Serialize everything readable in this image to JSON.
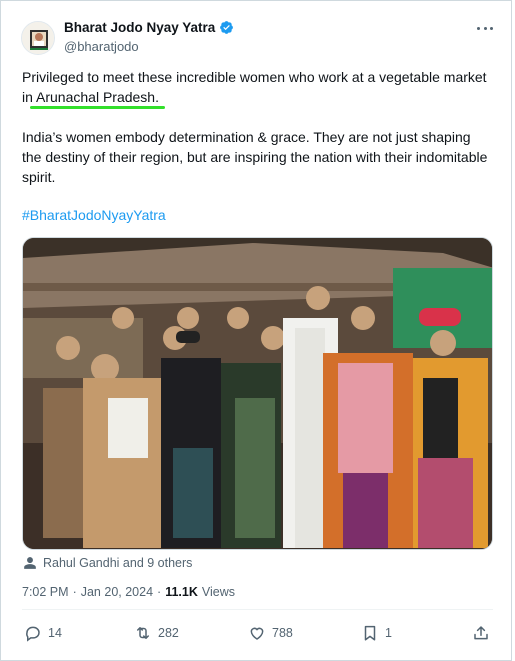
{
  "post": {
    "author": {
      "display_name": "Bharat Jodo Nyay Yatra",
      "handle": "@bharatjodo",
      "verified": true
    },
    "text": {
      "line1_before": "Privileged to meet these incredible women who work at a vegetable market in ",
      "line1_highlight": "Arunachal Pradesh.",
      "paragraph2": "India’s women embody determination & grace. They are not just shaping the destiny of their region, but are inspiring the nation with their indomitable spirit.",
      "hashtag": "#BharatJodoNyayYatra"
    },
    "tagged": "Rahul Gandhi and 9 others",
    "timestamp": {
      "time": "7:02 PM",
      "separator": "·",
      "date": "Jan 20, 2024",
      "views_count": "11.1K",
      "views_label": "Views"
    },
    "actions": {
      "replies": "14",
      "reposts": "282",
      "likes": "788",
      "bookmarks": "1"
    }
  },
  "colors": {
    "accent": "#1d9bf0",
    "highlight_underline": "#33e02b",
    "muted_text": "#536471"
  }
}
